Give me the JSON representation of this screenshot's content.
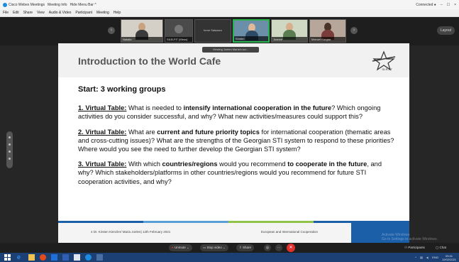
{
  "titlebar": {
    "app_title": "Cisco Webex Meetings",
    "meeting_info": "Meeting Info",
    "hide_menu": "Hide Menu Bar ^",
    "connected": "Connected ●"
  },
  "menu": [
    "File",
    "Edit",
    "Share",
    "View",
    "Audio & Video",
    "Participant",
    "Meeting",
    "Help"
  ],
  "participants": [
    {
      "name": "Natalia",
      "active": false
    },
    {
      "name": "SILB-FIT (Meus)",
      "active": false
    },
    {
      "name": "Irene Salazaro",
      "active": false
    },
    {
      "name": "Kirsten",
      "active": true
    },
    {
      "name": "Joanne",
      "active": false
    },
    {
      "name": "Manuel Kurgaa",
      "active": false
    }
  ],
  "layout_label": "Layout",
  "viewing_label": "Viewing Joelen Maria's scr...",
  "slide": {
    "title": "Introduction to the World Cafe",
    "logo_text": "DLR-PT",
    "start_heading": "Start: 3 working groups",
    "table1": {
      "label": "1. Virtual Table:",
      "t1": " What is needed to ",
      "bold1": "intensify international cooperation in the future",
      "t2": "? Which ongoing activities do you consider successful, and why? What new activities/measures could support this?"
    },
    "table2": {
      "label": "2. Virtual Table:",
      "t1": " What are ",
      "bold1": "current and future priority topics",
      "t2": " for international cooperation (thematic areas and cross-cutting issues)? What are the strengths of the Georgian STI system to respond to these priorities? Where would you see the need to further develop the Georgian STI system?"
    },
    "table3": {
      "label": "3. Virtual Table:",
      "t1": " With which ",
      "bold1": "countries/regions",
      "t2": " would you recommend ",
      "bold2": "to cooperate in the future",
      "t3": ", and why? Which stakeholders/platforms in other countries/regions would you recommend for future STI cooperation activities, and why?"
    },
    "footer_left": "4   Dr. Kirsten Kienzler/ Maria Joelen| 12th February 2021",
    "footer_right": "European and International Cooperation",
    "footer_colors": [
      "#1b5fa8",
      "#5aa0d8",
      "#8fc34a",
      "#1b5fa8"
    ]
  },
  "controls": {
    "unmute": "Unmute",
    "stop_video": "Stop video",
    "share": "Share",
    "participants": "Participants",
    "chat": "Chat"
  },
  "watermark": [
    "Activate Windows",
    "Go to Settings to activate Windows."
  ],
  "taskbar": {
    "time": "09:41",
    "date": "12/02/2021",
    "lang": "ENG"
  }
}
